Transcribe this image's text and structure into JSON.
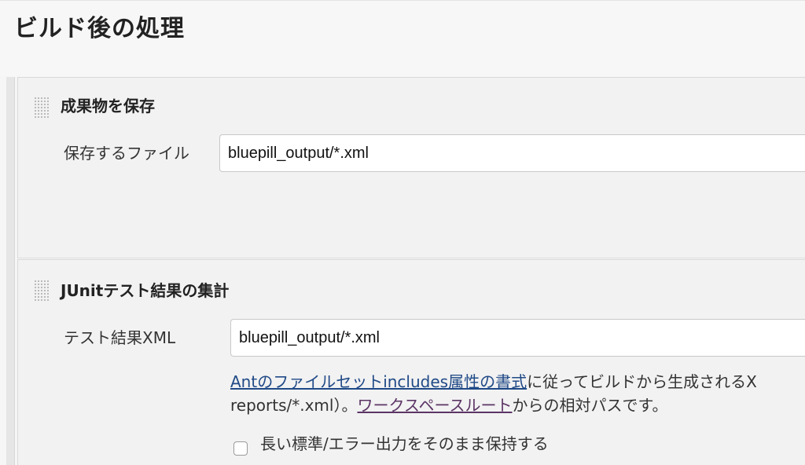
{
  "section": {
    "title": "ビルド後の処理"
  },
  "steps": {
    "archive": {
      "title": "成果物を保存",
      "field_label": "保存するファイル",
      "field_value": "bluepill_output/*.xml"
    },
    "junit": {
      "title": "JUnitテスト結果の集計",
      "field_label": "テスト結果XML",
      "field_value": "bluepill_output/*.xml",
      "help": {
        "link1": "Antのファイルセットincludes属性の書式",
        "text1": "に従ってビルドから生成されるX",
        "text2": "reports/*.xml）。",
        "link2": "ワークスペースルート",
        "text3": "からの相対パスです。"
      },
      "checkbox_label": "長い標準/エラー出力をそのまま保持する",
      "checkbox_checked": false
    }
  },
  "icons": {
    "drag_handle": "drag-handle-icon"
  },
  "colors": {
    "link": "#204a87",
    "visited_link": "#5c3566"
  }
}
